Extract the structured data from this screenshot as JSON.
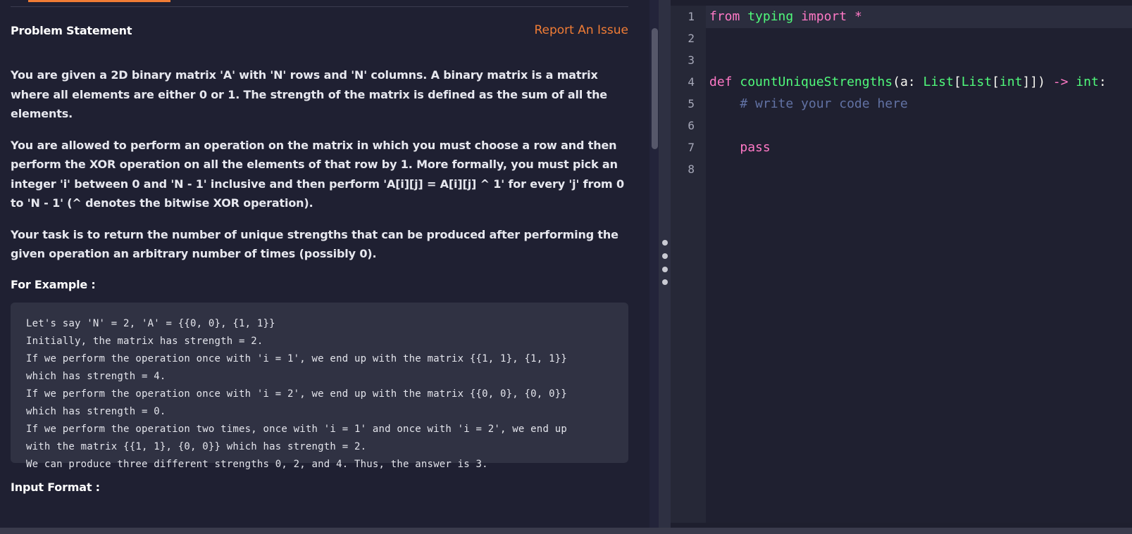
{
  "problem": {
    "heading": "Problem Statement",
    "report_link": "Report An Issue",
    "paragraphs": [
      "You are given a 2D binary matrix 'A' with 'N' rows and 'N' columns. A binary matrix is a matrix where all elements are either 0 or 1. The strength of the matrix is defined as the sum of all the elements.",
      "You are allowed to perform an operation on the matrix in which you must choose a row and then perform the XOR operation on all the elements of that row by 1. More formally, you must pick an integer 'i' between 0 and 'N - 1' inclusive and then perform 'A[i][j] = A[i][j] ^ 1' for every 'j' from 0 to 'N - 1' (^ denotes the bitwise XOR operation).",
      "Your task is to return the number of unique strengths that can be produced after performing the given operation an arbitrary number of times (possibly 0)."
    ],
    "example_heading": "For Example :",
    "example_lines": [
      "Let's say 'N' = 2, 'A' = {{0, 0}, {1, 1}}",
      "Initially, the matrix has strength = 2.",
      "If we perform the operation once with 'i = 1', we end up with the matrix {{1, 1}, {1, 1}}",
      "which has strength = 4.",
      "If we perform the operation once with 'i = 2', we end up with the matrix {{0, 0}, {0, 0}}",
      "which has strength = 0.",
      "If we perform the operation two times, once with 'i = 1' and once with 'i = 2', we end up",
      "with the matrix {{1, 1}, {0, 0}} which has strength = 2.",
      "We can produce three different strengths 0, 2, and 4. Thus, the answer is 3."
    ],
    "input_heading": "Input Format :"
  },
  "editor": {
    "line_numbers": [
      "1",
      "2",
      "3",
      "4",
      "5",
      "6",
      "7",
      "8"
    ],
    "tokens": {
      "l1_from": "from",
      "l1_typing": "typing",
      "l1_import": "import",
      "l1_star": "*",
      "l4_def": "def",
      "l4_fn": "countUniqueStrengths",
      "l4_open": "(",
      "l4_param": "a",
      "l4_colon": ": ",
      "l4_list1": "List",
      "l4_br1": "[",
      "l4_list2": "List",
      "l4_br2": "[",
      "l4_int1": "int",
      "l4_close": "]])",
      "l4_arrow": "->",
      "l4_int2": "int",
      "l4_end": ":",
      "l5_comment": "# write your code here",
      "l7_pass": "pass"
    },
    "colors": {
      "keyword": "#ff79c6",
      "identifier": "#50fa7b",
      "comment": "#6272a4"
    }
  }
}
